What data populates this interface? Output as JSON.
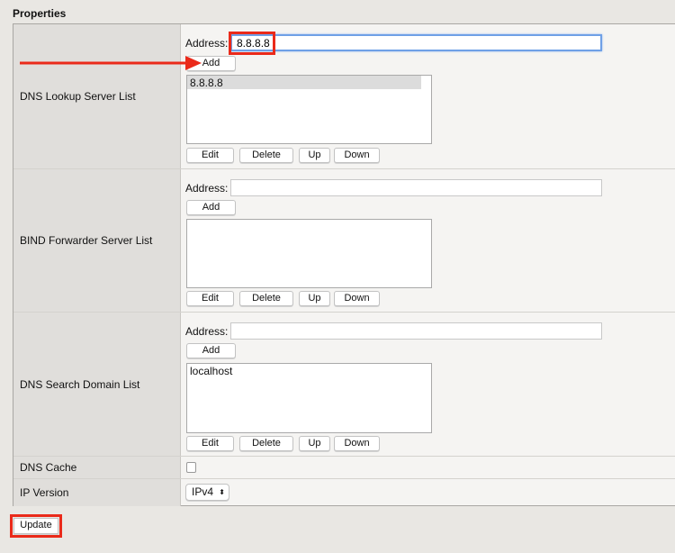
{
  "section_title": "Properties",
  "rows": {
    "dns_lookup": {
      "label": "DNS Lookup Server List",
      "address_label": "Address:",
      "address_value": "8.8.8.8",
      "add": "Add",
      "items": [
        "8.8.8.8"
      ],
      "edit": "Edit",
      "delete": "Delete",
      "up": "Up",
      "down": "Down"
    },
    "bind_forwarder": {
      "label": "BIND Forwarder Server List",
      "address_label": "Address:",
      "address_value": "",
      "add": "Add",
      "items": [],
      "edit": "Edit",
      "delete": "Delete",
      "up": "Up",
      "down": "Down"
    },
    "search_domain": {
      "label": "DNS Search Domain List",
      "address_label": "Address:",
      "address_value": "",
      "add": "Add",
      "items": [
        "localhost"
      ],
      "edit": "Edit",
      "delete": "Delete",
      "up": "Up",
      "down": "Down"
    },
    "dns_cache": {
      "label": "DNS Cache",
      "checked": false
    },
    "ip_version": {
      "label": "IP Version",
      "value": "IPv4"
    }
  },
  "update": "Update",
  "colors": {
    "highlight": "#ea2a1a",
    "focus": "#6fa0e6"
  }
}
